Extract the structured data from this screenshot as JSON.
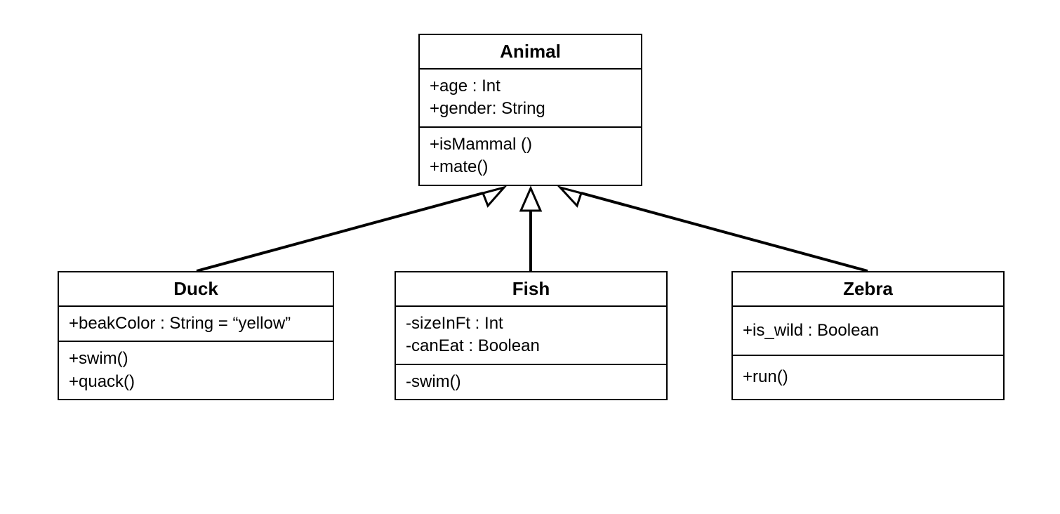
{
  "diagram": {
    "type": "uml-class",
    "relationship": "inheritance",
    "classes": {
      "animal": {
        "name": "Animal",
        "attributes": [
          "+age : Int",
          "+gender: String"
        ],
        "methods": [
          "+isMammal ()",
          "+mate()"
        ]
      },
      "duck": {
        "name": "Duck",
        "attributes": [
          "+beakColor : String = “yellow”"
        ],
        "methods": [
          "+swim()",
          "+quack()"
        ]
      },
      "fish": {
        "name": "Fish",
        "attributes": [
          "-sizeInFt : Int",
          "-canEat : Boolean"
        ],
        "methods": [
          "-swim()"
        ]
      },
      "zebra": {
        "name": "Zebra",
        "attributes": [
          "+is_wild : Boolean"
        ],
        "methods": [
          "+run()"
        ]
      }
    }
  }
}
